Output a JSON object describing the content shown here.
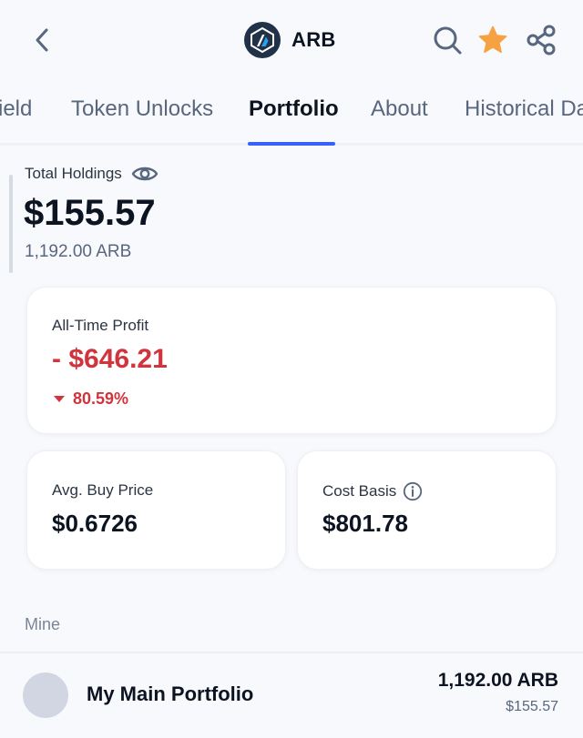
{
  "header": {
    "title": "ARB",
    "back_icon": "chevron-left-icon",
    "search_icon": "search-icon",
    "star_icon": "star-icon",
    "share_icon": "share-icon",
    "star_color": "#f6a243",
    "brand_logo_color": "#213147"
  },
  "tabs": [
    {
      "label": "ield",
      "active": false
    },
    {
      "label": "Token Unlocks",
      "active": false
    },
    {
      "label": "Portfolio",
      "active": true
    },
    {
      "label": "About",
      "active": false
    },
    {
      "label": "Historical Da",
      "active": false
    }
  ],
  "accent_color": "#3861fb",
  "holdings": {
    "label": "Total Holdings",
    "value": "$155.57",
    "amount": "1,192.00 ARB"
  },
  "profit": {
    "label": "All-Time Profit",
    "value": "- $646.21",
    "percent": "80.59%",
    "color": "#d0343d"
  },
  "avg_buy": {
    "label": "Avg. Buy Price",
    "value": "$0.6726"
  },
  "cost_basis": {
    "label": "Cost Basis",
    "value": "$801.78"
  },
  "mine": {
    "label": "Mine",
    "portfolios": [
      {
        "name": "My Main Portfolio",
        "amount": "1,192.00 ARB",
        "value": "$155.57"
      }
    ]
  }
}
